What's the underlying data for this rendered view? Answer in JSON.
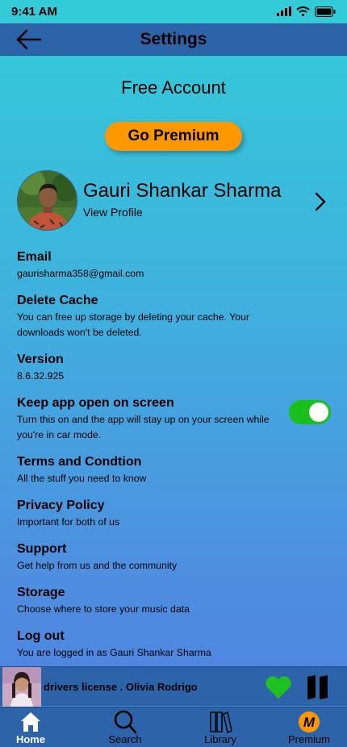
{
  "status_bar": {
    "time": "9:41 AM"
  },
  "header": {
    "title": "Settings",
    "back_icon": "arrow-left-icon"
  },
  "account": {
    "type": "Free Account",
    "premium_button": "Go Premium"
  },
  "profile": {
    "name": "Gauri Shankar Sharma",
    "view_label": "View Profile"
  },
  "settings": [
    {
      "title": "Email",
      "desc": "gaurisharma358@gmail.com"
    },
    {
      "title": "Delete Cache",
      "desc": "You can free up storage by deleting your cache. Your downloads won't be deleted."
    },
    {
      "title": "Version",
      "desc": "8.6.32.925"
    },
    {
      "title": "Keep app open on screen",
      "desc": "Turn this on and the app will stay up on your screen while you're in car mode.",
      "toggle_on": true
    },
    {
      "title": "Terms and Condtion",
      "desc": "All the stuff you need to know"
    },
    {
      "title": "Privacy Policy",
      "desc": "Important for both of us"
    },
    {
      "title": "Support",
      "desc": "Get help from us and the community"
    },
    {
      "title": "Storage",
      "desc": "Choose where to store your music data"
    },
    {
      "title": "Log out",
      "desc": "You are logged in as Gauri Shankar Sharma"
    }
  ],
  "player": {
    "track": "drivers license . Olivia Rodrigo",
    "liked": true,
    "heart_color": "#1fc11f"
  },
  "nav": [
    {
      "label": "Home",
      "icon": "home-icon",
      "active": true
    },
    {
      "label": "Search",
      "icon": "search-icon"
    },
    {
      "label": "Library",
      "icon": "library-icon"
    },
    {
      "label": "Premium",
      "icon": "premium-icon"
    }
  ],
  "colors": {
    "bar": "#2d63a8",
    "accent": "#ff9800",
    "toggle_on": "#19c01b"
  }
}
